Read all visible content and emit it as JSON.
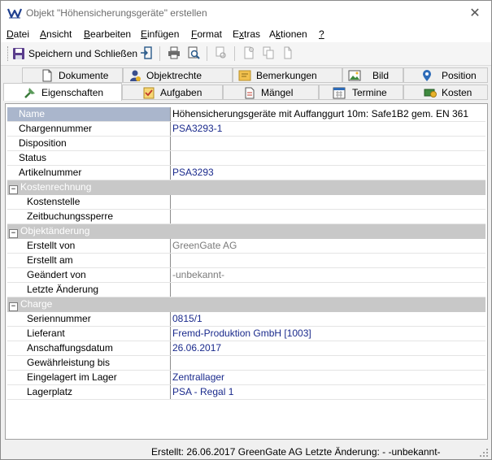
{
  "window": {
    "title": "Objekt \"Höhensicherungsgeräte\" erstellen",
    "close_glyph": "✕"
  },
  "menu": [
    {
      "label": "Datei",
      "key": "D"
    },
    {
      "label": "Ansicht",
      "key": "A"
    },
    {
      "label": "Bearbeiten",
      "key": "B"
    },
    {
      "label": "Einfügen",
      "key": "E"
    },
    {
      "label": "Format",
      "key": "F"
    },
    {
      "label": "Extras",
      "key": "x"
    },
    {
      "label": "Aktionen",
      "key": "k"
    },
    {
      "label": "?",
      "key": "?"
    }
  ],
  "toolbar": {
    "save_label": "Speichern und Schließen",
    "icons": [
      "exit-icon",
      "print-icon",
      "print-preview-icon",
      "copy-format-icon",
      "new-document-icon",
      "duplicate-icon",
      "paste-icon"
    ]
  },
  "tabs": {
    "back_row": [
      {
        "label": "Dokumente",
        "icon": "document-icon"
      },
      {
        "label": "Objektrechte",
        "icon": "user-rights-icon"
      },
      {
        "label": "Bemerkungen",
        "icon": "note-icon"
      },
      {
        "label": "Bild",
        "icon": "image-icon"
      },
      {
        "label": "Position",
        "icon": "location-pin-icon"
      }
    ],
    "front_row": [
      {
        "label": "Eigenschaften",
        "icon": "properties-icon",
        "active": true
      },
      {
        "label": "Aufgaben",
        "icon": "task-icon"
      },
      {
        "label": "Mängel",
        "icon": "defect-icon"
      },
      {
        "label": "Termine",
        "icon": "calendar-icon"
      },
      {
        "label": "Kosten",
        "icon": "money-icon"
      }
    ]
  },
  "properties": [
    {
      "type": "row",
      "label": "Name",
      "value": "Höhensicherungsgeräte mit Auffanggurt 10m: Safe1B2 gem. EN 361",
      "selected": true,
      "style": "black"
    },
    {
      "type": "row",
      "label": "Chargennummer",
      "value": "PSA3293-1",
      "style": "blue"
    },
    {
      "type": "row",
      "label": "Disposition",
      "value": ""
    },
    {
      "type": "row",
      "label": "Status",
      "value": ""
    },
    {
      "type": "row",
      "label": "Artikelnummer",
      "value": "PSA3293",
      "style": "blue"
    },
    {
      "type": "category",
      "label": "Kostenrechnung",
      "collapse_glyph": "−"
    },
    {
      "type": "row",
      "label": "Kostenstelle",
      "value": "",
      "sub": true
    },
    {
      "type": "row",
      "label": "Zeitbuchungssperre",
      "value": "",
      "sub": true
    },
    {
      "type": "category",
      "label": "Objektänderung",
      "collapse_glyph": "−"
    },
    {
      "type": "row",
      "label": "Erstellt von",
      "value": "GreenGate AG",
      "sub": true,
      "style": "gray"
    },
    {
      "type": "row",
      "label": "Erstellt am",
      "value": "",
      "sub": true
    },
    {
      "type": "row",
      "label": "Geändert von",
      "value": "-unbekannt-",
      "sub": true,
      "style": "gray"
    },
    {
      "type": "row",
      "label": "Letzte Änderung",
      "value": "",
      "sub": true
    },
    {
      "type": "category",
      "label": "Charge",
      "collapse_glyph": "−"
    },
    {
      "type": "row",
      "label": "Seriennummer",
      "value": "0815/1",
      "sub": true,
      "style": "blue"
    },
    {
      "type": "row",
      "label": "Lieferant",
      "value": "Fremd-Produktion GmbH [1003]",
      "sub": true,
      "style": "blue"
    },
    {
      "type": "row",
      "label": "Anschaffungsdatum",
      "value": "26.06.2017",
      "sub": true,
      "style": "blue"
    },
    {
      "type": "row",
      "label": "Gewährleistung bis",
      "value": "",
      "sub": true
    },
    {
      "type": "row",
      "label": "Eingelagert im Lager",
      "value": "Zentrallager",
      "sub": true,
      "style": "blue"
    },
    {
      "type": "row",
      "label": "Lagerplatz",
      "value": "PSA - Regal 1",
      "sub": true,
      "style": "blue"
    }
  ],
  "status": {
    "text": "Erstellt: 26.06.2017 GreenGate AG  Letzte Änderung: - -unbekannt-"
  },
  "colors": {
    "selected_label_bg": "#aab6cc",
    "category_bg": "#c8c8c8",
    "value_blue": "#1a2a8c",
    "value_gray": "#7a7a7a"
  }
}
